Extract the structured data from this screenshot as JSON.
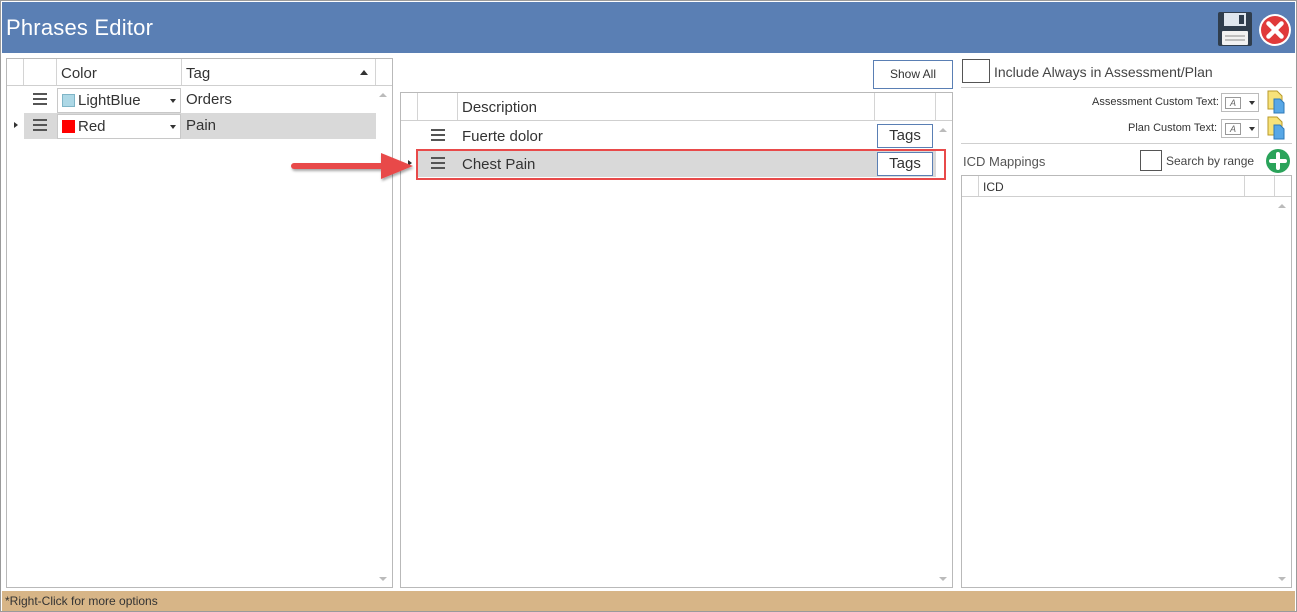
{
  "window": {
    "title": "Phrases Editor"
  },
  "icons": {
    "save": "floppy-disk-icon",
    "close": "close-icon",
    "row_handle": "drag-handle-icon",
    "add": "plus-icon",
    "paste": "paste-icon"
  },
  "colors": {
    "titlebar": "#5a7fb4",
    "statusbar": "#d7b587",
    "selected_row": "#d9d9d9",
    "highlight_border": "#e84a4a",
    "arrow": "#e84a4a",
    "close_red": "#e03a3a",
    "add_green": "#2aa35a"
  },
  "tags_grid": {
    "columns": [
      "Color",
      "Tag"
    ],
    "rows": [
      {
        "color_name": "LightBlue",
        "swatch": "#add8e6",
        "tag": "Orders"
      },
      {
        "color_name": "Red",
        "swatch": "#ff0000",
        "tag": "Pain"
      }
    ]
  },
  "phrases": {
    "show_all_label": "Show All",
    "columns": [
      "Description"
    ],
    "rows": [
      {
        "description": "Fuerte dolor",
        "tags_label": "Tags"
      },
      {
        "description": "Chest Pain",
        "tags_label": "Tags"
      }
    ]
  },
  "right_panel": {
    "include_always_label": "Include Always in Assessment/Plan",
    "assessment_custom_text_label": "Assessment Custom Text:",
    "plan_custom_text_label": "Plan Custom Text:",
    "icd_mappings_label": "ICD Mappings",
    "search_by_range_label": "Search by range",
    "icd_columns": [
      "ICD"
    ],
    "custom_text_glyph": "A"
  },
  "status": {
    "text": "*Right-Click for more options"
  }
}
